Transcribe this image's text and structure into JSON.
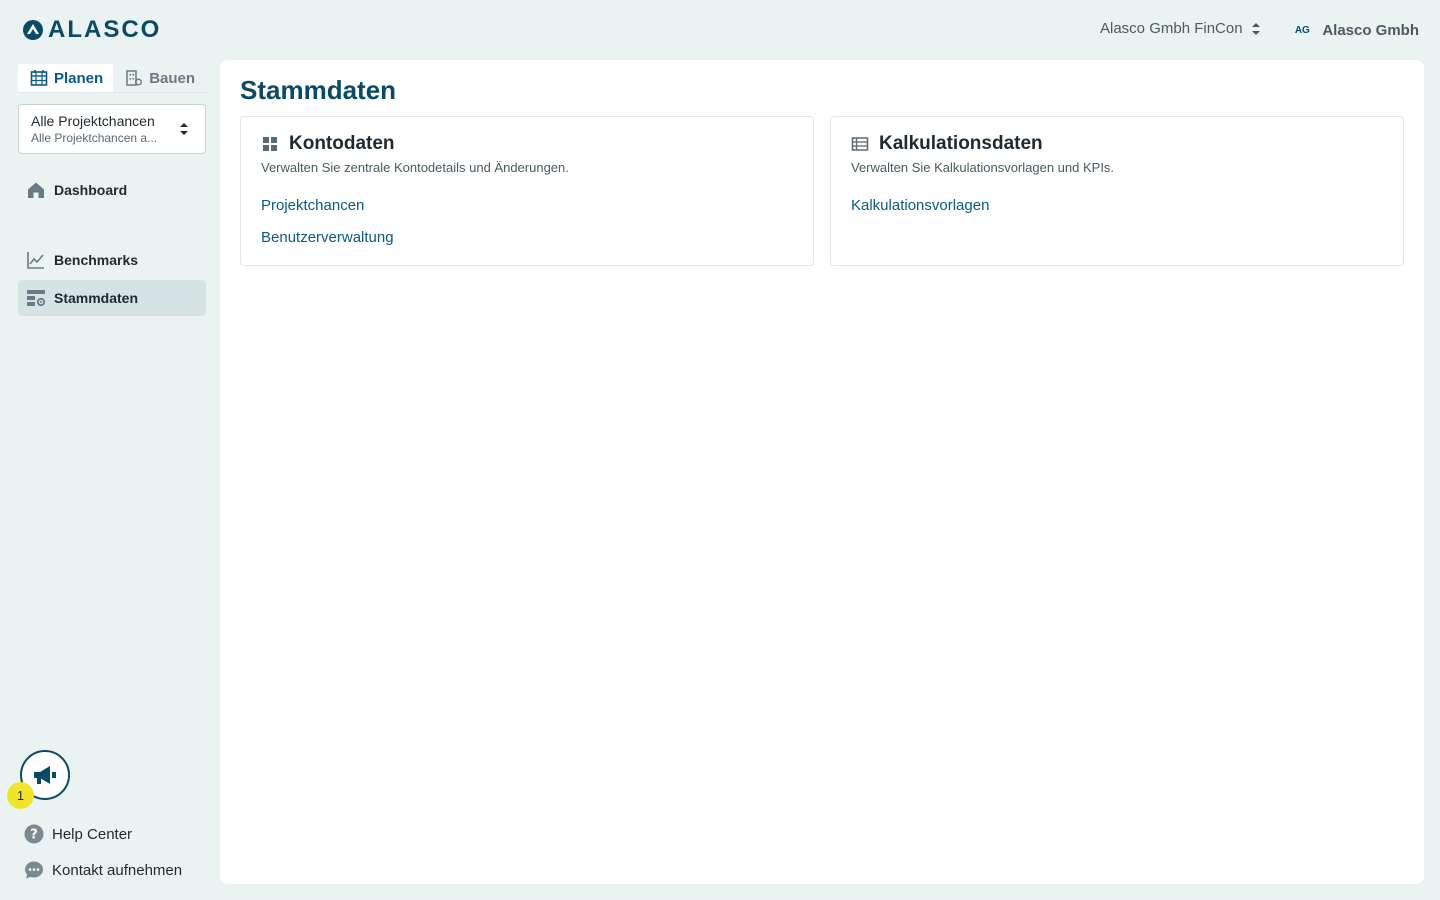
{
  "header": {
    "logo_text": "ALASCO",
    "org_switcher": "Alasco Gmbh FinCon",
    "user_initials": "AG",
    "user_name": "Alasco Gmbh"
  },
  "sidebar": {
    "tabs": [
      {
        "label": "Planen",
        "active": true
      },
      {
        "label": "Bauen",
        "active": false
      }
    ],
    "project_select": {
      "title": "Alle Projektchancen",
      "subtitle": "Alle Projektchancen a..."
    },
    "nav": [
      {
        "label": "Dashboard",
        "icon": "home-icon",
        "active": false
      },
      {
        "label": "Benchmarks",
        "icon": "chart-line-icon",
        "active": false
      },
      {
        "label": "Stammdaten",
        "icon": "settings-table-icon",
        "active": true
      }
    ],
    "announcement_badge": "1",
    "bottom_links": [
      {
        "label": "Help Center",
        "icon": "help-icon"
      },
      {
        "label": "Kontakt aufnehmen",
        "icon": "chat-icon"
      }
    ]
  },
  "main": {
    "title": "Stammdaten",
    "cards": [
      {
        "title": "Kontodaten",
        "icon": "grid-icon",
        "description": "Verwalten Sie zentrale Kontodetails und Änderungen.",
        "links": [
          "Projektchancen",
          "Benutzerverwaltung"
        ]
      },
      {
        "title": "Kalkulationsdaten",
        "icon": "table-icon",
        "description": "Verwalten Sie Kalkulationsvorlagen und KPIs.",
        "links": [
          "Kalkulationsvorlagen"
        ]
      }
    ]
  },
  "colors": {
    "brand": "#0a4a66",
    "link": "#0a5a86",
    "background": "#ebf2f2",
    "active_nav": "#d5e3e5",
    "badge": "#f0e52a"
  }
}
